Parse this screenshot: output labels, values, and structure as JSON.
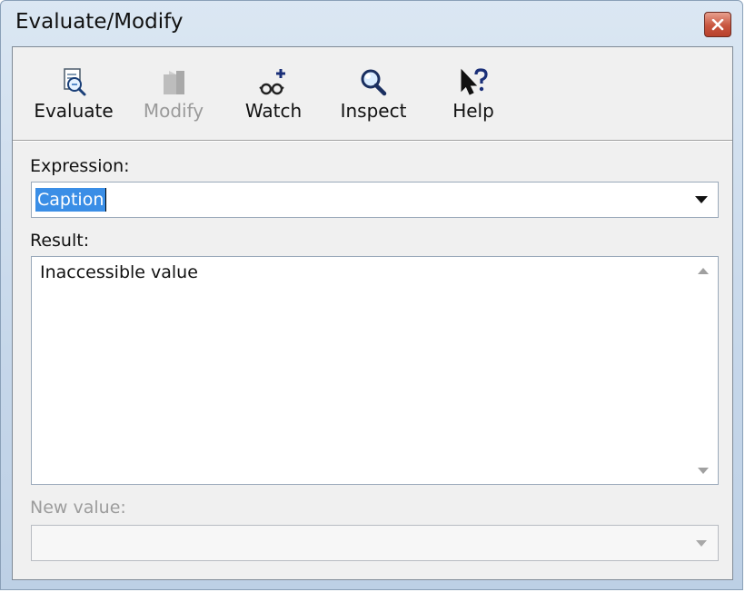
{
  "window": {
    "title": "Evaluate/Modify",
    "close_icon": "close-icon"
  },
  "toolbar": {
    "items": [
      {
        "label": "Evaluate",
        "icon": "evaluate-icon",
        "enabled": true
      },
      {
        "label": "Modify",
        "icon": "modify-icon",
        "enabled": false
      },
      {
        "label": "Watch",
        "icon": "watch-icon",
        "enabled": true
      },
      {
        "label": "Inspect",
        "icon": "inspect-icon",
        "enabled": true
      },
      {
        "label": "Help",
        "icon": "help-icon",
        "enabled": true
      }
    ]
  },
  "expression": {
    "label": "Expression:",
    "value": "Caption"
  },
  "result": {
    "label": "Result:",
    "value": "Inaccessible value"
  },
  "new_value": {
    "label": "New value:",
    "value": "",
    "enabled": false
  },
  "colors": {
    "selection": "#3a8ee6",
    "close_button": "#c8553f",
    "disabled_text": "#9c9c9c"
  }
}
